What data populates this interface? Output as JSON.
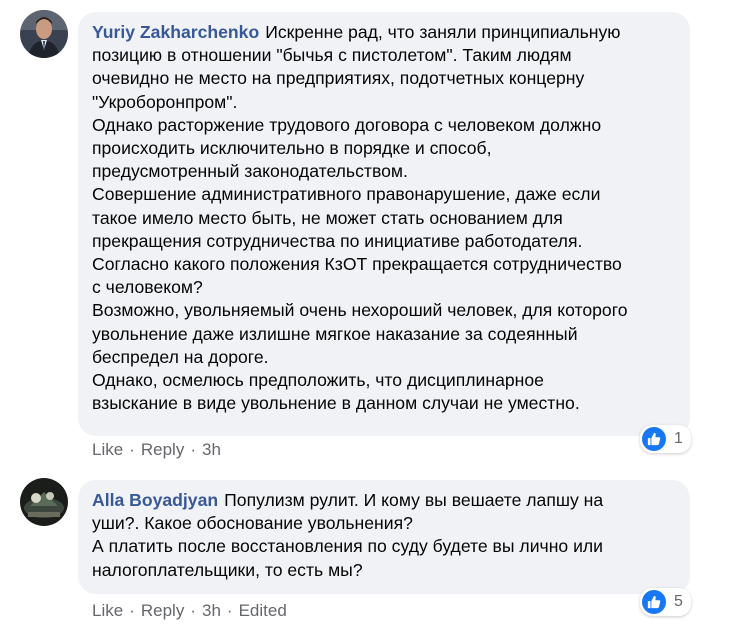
{
  "comments": [
    {
      "author": "Yuriy Zakharchenko",
      "lines": [
        "Искренне рад, что заняли принципиальную",
        "позицию в отношении \"бычья с пистолетом\". Таким людям",
        "очевидно не место на предприятиях, подотчетных концерну",
        "\"Укроборонпром\".",
        "Однако расторжение трудового договора с человеком должно",
        "происходить исключительно в порядке и способ,",
        "предусмотренный законодательством.",
        "Совершение административного правонарушение, даже если",
        "такое имело место быть, не может стать основанием для",
        "прекращения сотрудничества по инициативе работодателя.",
        "Согласно какого положения КзОТ прекращается сотрудничество",
        "с человеком?",
        "Возможно, увольняемый очень нехороший человек, для которого",
        "увольнение даже излишне мягкое наказание за содеянный",
        "беспредел на дороге.",
        "Однако, осмелюсь предположить, что дисциплинарное",
        "взыскание в виде увольнение в данном случаи не уместно."
      ],
      "actions": {
        "like": "Like",
        "reply": "Reply",
        "time": "3h",
        "edited": ""
      },
      "reaction_count": "1"
    },
    {
      "author": "Alla Boyadjyan",
      "lines": [
        "Популизм рулит. И кому вы вешаете лапшу на",
        "уши?. Какое обоснование увольнения?",
        "А платить после восстановления по суду будете вы лично или",
        "налогоплательщики, то есть мы?"
      ],
      "actions": {
        "like": "Like",
        "reply": "Reply",
        "time": "3h",
        "edited": "Edited"
      },
      "reaction_count": "5"
    }
  ],
  "colors": {
    "author": "#385898",
    "bubble": "#f0f2f5",
    "meta": "#65676b",
    "like_badge": "#1877f2"
  },
  "icons": {
    "reaction": "like-thumb-icon",
    "avatar_1": "profile-photo-man-suit",
    "avatar_2": "profile-photo-dark-scene"
  }
}
